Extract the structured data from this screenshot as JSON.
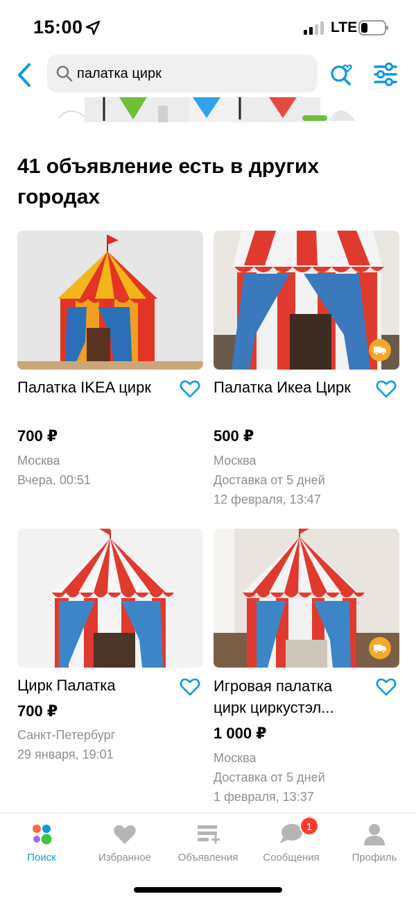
{
  "status_bar": {
    "time": "15:00",
    "network": "LTE"
  },
  "search": {
    "query": "палатка цирк"
  },
  "section": {
    "title": "41 объявление есть в других городах"
  },
  "listings": [
    {
      "title": "Палатка IKEA цирк",
      "price": "700 ₽",
      "city": "Москва",
      "delivery": "",
      "date": "Вчера, 00:51",
      "has_delivery_badge": false
    },
    {
      "title": "Палатка Икеа Цирк",
      "price": "500 ₽",
      "city": "Москва",
      "delivery": "Доставка от 5 дней",
      "date": "12 февраля, 13:47",
      "has_delivery_badge": true
    },
    {
      "title": "Цирк Палатка",
      "price": "700 ₽",
      "city": "Санкт-Петербург",
      "delivery": "",
      "date": "29 января, 19:01",
      "has_delivery_badge": false
    },
    {
      "title": "Игровая палатка цирк циркустэл...",
      "price": "1 000 ₽",
      "city": "Москва",
      "delivery": "Доставка от 5 дней",
      "date": "1 февраля, 13:37",
      "has_delivery_badge": true
    }
  ],
  "tabbar": {
    "tabs": [
      {
        "label": "Поиск",
        "icon": "search-dots-icon",
        "active": true
      },
      {
        "label": "Избранное",
        "icon": "heart-icon",
        "active": false
      },
      {
        "label": "Объявления",
        "icon": "listings-icon",
        "active": false
      },
      {
        "label": "Сообщения",
        "icon": "chat-icon",
        "active": false,
        "badge": "1"
      },
      {
        "label": "Профиль",
        "icon": "profile-icon",
        "active": false
      }
    ]
  },
  "colors": {
    "accent": "#0a97e6",
    "meta": "#8f8f8f",
    "delivery": "#f3a928",
    "badge": "#ff3b30"
  }
}
